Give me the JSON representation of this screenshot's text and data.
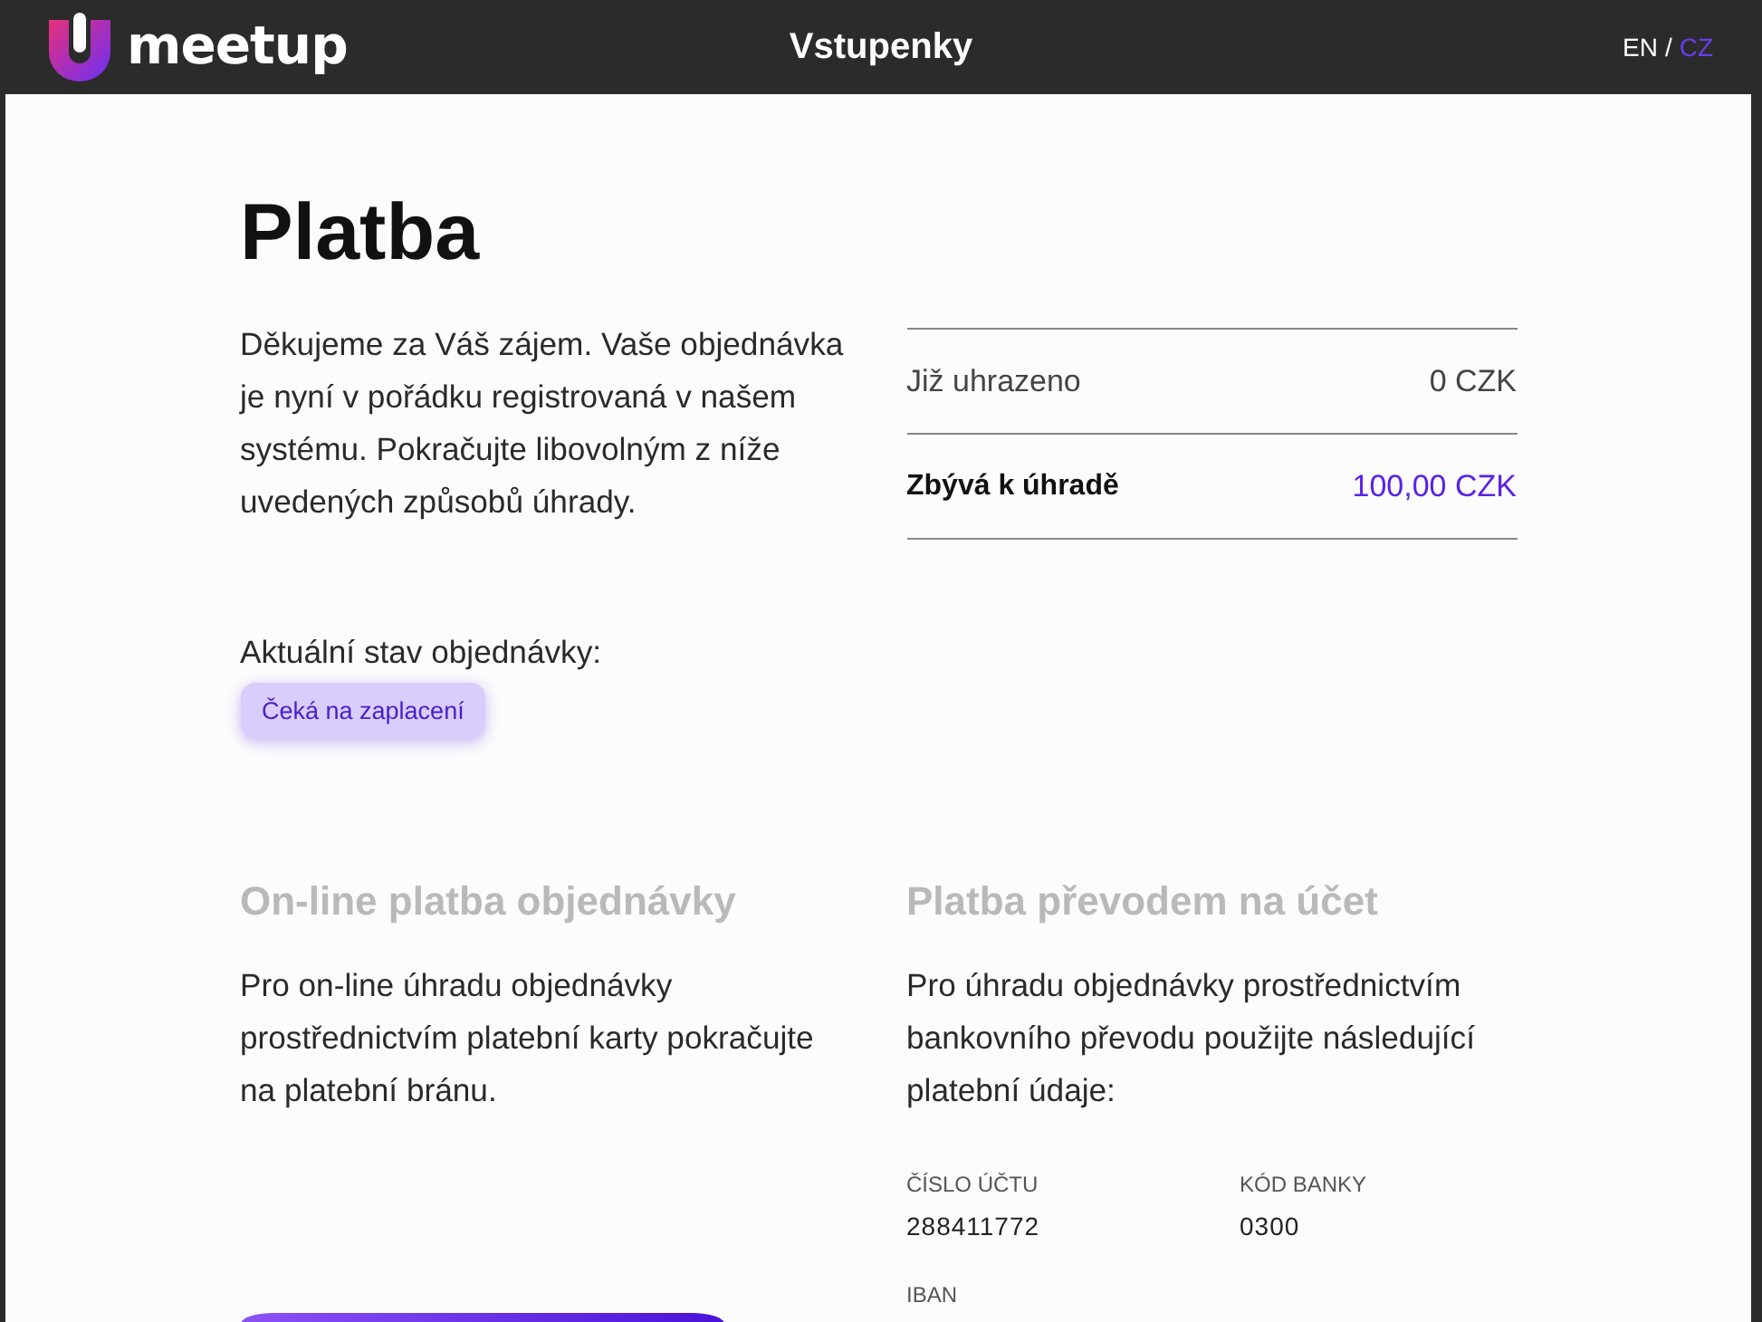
{
  "header": {
    "logo_text": "meetup",
    "title": "Vstupenky",
    "separator": "/",
    "languages": [
      {
        "label": "EN",
        "selected": false
      },
      {
        "label": "CZ",
        "selected": true
      }
    ]
  },
  "page": {
    "title": "Platba",
    "intro": "Děkujeme za Váš zájem. Vaše objednávka je nyní v pořádku registrovaná v našem systému. Pokračujte libovolným z níže uvedených způsobů úhrady.",
    "summary": [
      {
        "kind": "paid",
        "label": "Již uhrazeno",
        "value": "0 CZK"
      },
      {
        "kind": "due",
        "label": "Zbývá k úhradě",
        "value": "100,00 CZK"
      }
    ],
    "status": {
      "label": "Aktuální stav objednávky:",
      "badge": "Čeká na zaplacení"
    }
  },
  "online": {
    "title": "On-line platba objednávky",
    "text": "Pro on-line úhradu objednávky prostřednictvím platební karty pokračujte na platební bránu."
  },
  "bank": {
    "title": "Platba převodem na účet",
    "text": "Pro úhradu objednávky prostřednictvím bankovního převodu použijte následující platební údaje:",
    "fields": [
      {
        "label": "ČÍSLO ÚČTU",
        "value": "288411772"
      },
      {
        "label": "KÓD BANKY",
        "value": "0300"
      },
      {
        "label": "IBAN"
      }
    ]
  }
}
